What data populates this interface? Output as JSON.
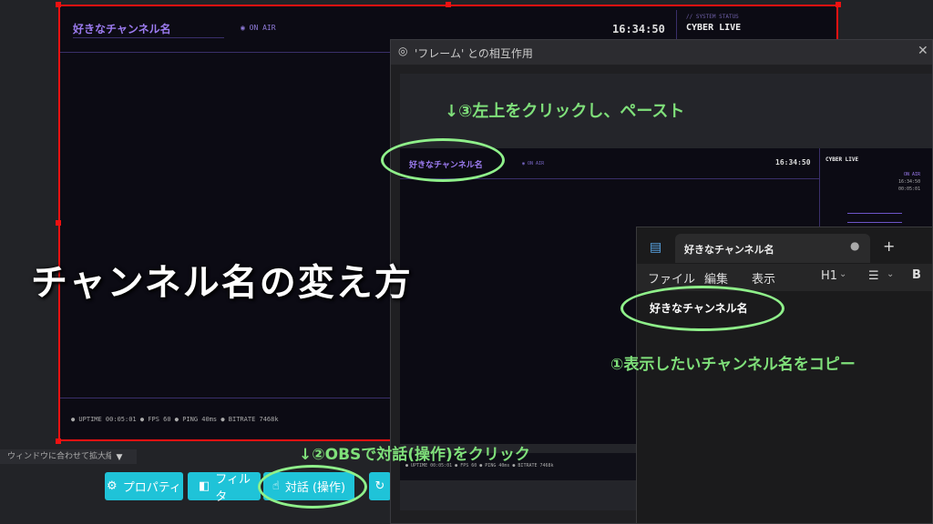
{
  "obs": {
    "channel_name": "好きなチャンネル名",
    "on_air": "◉ ON AIR",
    "clock": "16:34:50",
    "system": "// SYSTEM STATUS",
    "brand": "CYBER LIVE",
    "stats": "● UPTIME 00:05:01   ● FPS 60   ● PING 40ms   ● BITRATE 7468k",
    "zoom_label": "ウィンドウに合わせて拡大縮小",
    "buttons": {
      "properties": "プロパティ",
      "filters": "フィルタ",
      "interact": "対話 (操作)"
    }
  },
  "interact_window": {
    "title": "'フレーム' との相互作用",
    "channel_name": "好きなチャンネル名",
    "on_air": "◉ ON AIR",
    "clock": "16:34:50",
    "brand": "CYBER LIVE",
    "side_on_air": "ON AIR",
    "side_time": "16:34:50",
    "side_uptime": "00:05:01",
    "stats": "● UPTIME 00:05:01  ● FPS 60  ● PING 40ms  ● BITRATE 7468k"
  },
  "notepad": {
    "tab_title": "好きなチャンネル名",
    "menu": [
      "ファイル",
      "編集",
      "表示"
    ],
    "heading": "H1",
    "bold": "B",
    "content": "好きなチャンネル名"
  },
  "annotations": {
    "main_title": "チャンネル名の変え方",
    "step1": "①表示したいチャンネル名をコピー",
    "step2": "↓②OBSで対話(操作)をクリック",
    "step3": "↓③左上をクリックし、ペースト"
  },
  "colors": {
    "accent": "#9c7bf0",
    "obs_button": "#1fc3d8",
    "annotation": "#7fe07a",
    "border_red": "#e11"
  }
}
